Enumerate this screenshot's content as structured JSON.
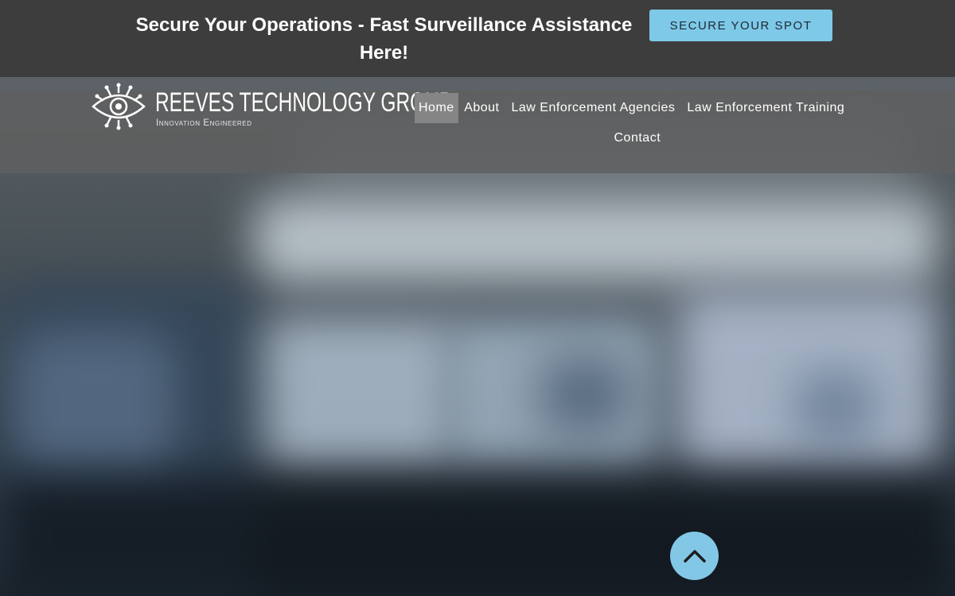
{
  "announcement": {
    "text": "Secure Your Operations - Fast Surveillance Assistance Here!",
    "cta_label": "SECURE YOUR SPOT"
  },
  "brand": {
    "name": "REEVES TECHNOLOGY GROUP",
    "tagline": "Innovation Engineered",
    "icon": "eye-circuit-logo-icon"
  },
  "nav": {
    "items": [
      {
        "label": "Home",
        "active": true
      },
      {
        "label": "About",
        "active": false
      },
      {
        "label": "Law Enforcement Agencies",
        "active": false
      },
      {
        "label": "Law Enforcement Training",
        "active": false
      },
      {
        "label": "Contact",
        "active": false
      }
    ]
  },
  "scroll_top": {
    "icon": "chevron-up-icon"
  },
  "colors": {
    "announcement_bg": "#3d3d3d",
    "accent": "#7ec8e8",
    "navbar_bg": "#5f5f5f",
    "nav_active_bg": "#858585",
    "text": "#ffffff"
  }
}
